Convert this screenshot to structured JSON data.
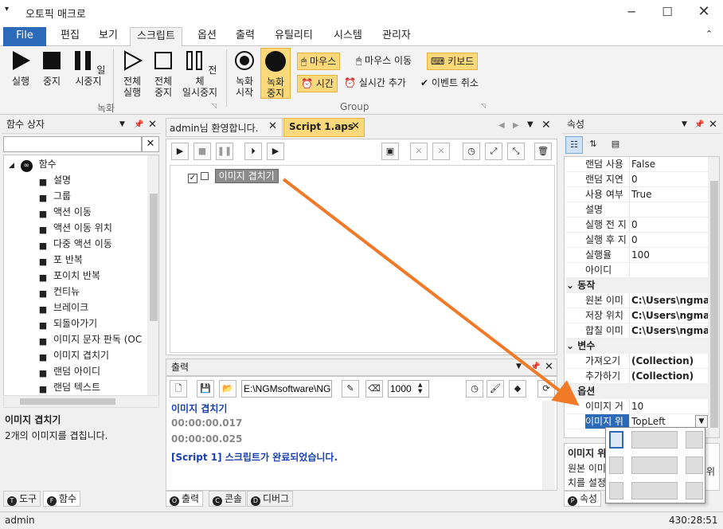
{
  "window": {
    "title": "오토픽 매크로"
  },
  "menu": {
    "file": "File",
    "edit": "편집",
    "view": "보기",
    "script": "스크립트",
    "options": "옵션",
    "output": "출력",
    "utility": "유틸리티",
    "system": "시스템",
    "admin": "관리자"
  },
  "ribbon": {
    "run": "실행",
    "stop": "중지",
    "pause": "일시중지",
    "run_all": [
      "전체",
      "실행"
    ],
    "stop_all": [
      "전체",
      "중지"
    ],
    "pause_all": [
      "전체",
      "일시중지"
    ],
    "rec_start": [
      "녹화",
      "시작"
    ],
    "rec_stop": [
      "녹화",
      "중지"
    ],
    "group_record": "녹화",
    "group_group": "Group",
    "mouse": "마우스",
    "mouse_move": "마우스 이동",
    "keyboard": "키보드",
    "time": "시간",
    "realtime_add": "실시간 추가",
    "event_cancel": "이벤트 취소"
  },
  "function_box": {
    "title": "함수 상자",
    "root": "함수",
    "items": [
      "설명",
      "그룹",
      "액션 이동",
      "액션 이동 위치",
      "다중 액션 이동",
      "포 반복",
      "포이치 반복",
      "컨티뉴",
      "브레이크",
      "되돌아가기",
      "이미지 문자 판독 (OC",
      "이미지 겹치기",
      "랜덤 아이디",
      "랜덤 텍스트"
    ],
    "icons": [
      "comment-icon",
      "group-icon",
      "action-move-icon",
      "action-position-icon",
      "multi-action-icon",
      "for-loop-icon",
      "foreach-loop-icon",
      "continue-icon",
      "break-icon",
      "return-icon",
      "ocr-icon",
      "image-overlay-icon",
      "random-id-icon",
      "random-text-icon"
    ],
    "desc_title": "이미지 겹치기",
    "desc_text": "2개의 이미지를 겹칩니다.",
    "tab_tools": "도구",
    "tab_functions": "함수"
  },
  "editor": {
    "tab_welcome": "admin님 환영합니다.",
    "tab_script": "Script 1.aps",
    "node": "이미지 겹치기"
  },
  "output": {
    "title": "출력",
    "path": "E:\\NGMsoftware\\NG",
    "count": "1000",
    "lines": [
      "이미지 겹치기",
      "00:00:00.017",
      "00:00:00.025",
      "[Script 1] 스크립트가 완료되었습니다."
    ],
    "tab_output": "출력",
    "tab_console": "콘솔",
    "tab_debug": "디버그"
  },
  "properties": {
    "title": "속성",
    "rows1": [
      [
        "랜덤 사용",
        "False"
      ],
      [
        "랜덤 지연",
        "0"
      ],
      [
        "사용 여부",
        "True"
      ],
      [
        "설명",
        ""
      ],
      [
        "실행 전 지",
        "0"
      ],
      [
        "실행 후 지",
        "0"
      ],
      [
        "실행율",
        "100"
      ],
      [
        "아이디",
        ""
      ]
    ],
    "cat_action": "동작",
    "rows2": [
      [
        "원본 이미",
        "C:\\Users\\ngma"
      ],
      [
        "저장 위치",
        "C:\\Users\\ngma"
      ],
      [
        "합칠 이미",
        "C:\\Users\\ngma"
      ]
    ],
    "cat_var": "변수",
    "rows3": [
      [
        "가져오기",
        "(Collection)"
      ],
      [
        "추가하기",
        "(Collection)"
      ]
    ],
    "cat_option": "옵션",
    "rows4": [
      [
        "이미지 거",
        "10"
      ],
      [
        "이미지 위",
        "TopLeft"
      ]
    ],
    "desc_title": "이미지 위",
    "desc_text1": "원본 이미",
    "desc_text2": "치를 설정",
    "desc_right": "위",
    "tab": "속성"
  },
  "status": {
    "user": "admin",
    "time": "430:28:51"
  },
  "colors": {
    "accent": "#2a6ab8",
    "highlight": "#fbd87a",
    "arrow": "#f07a28"
  }
}
